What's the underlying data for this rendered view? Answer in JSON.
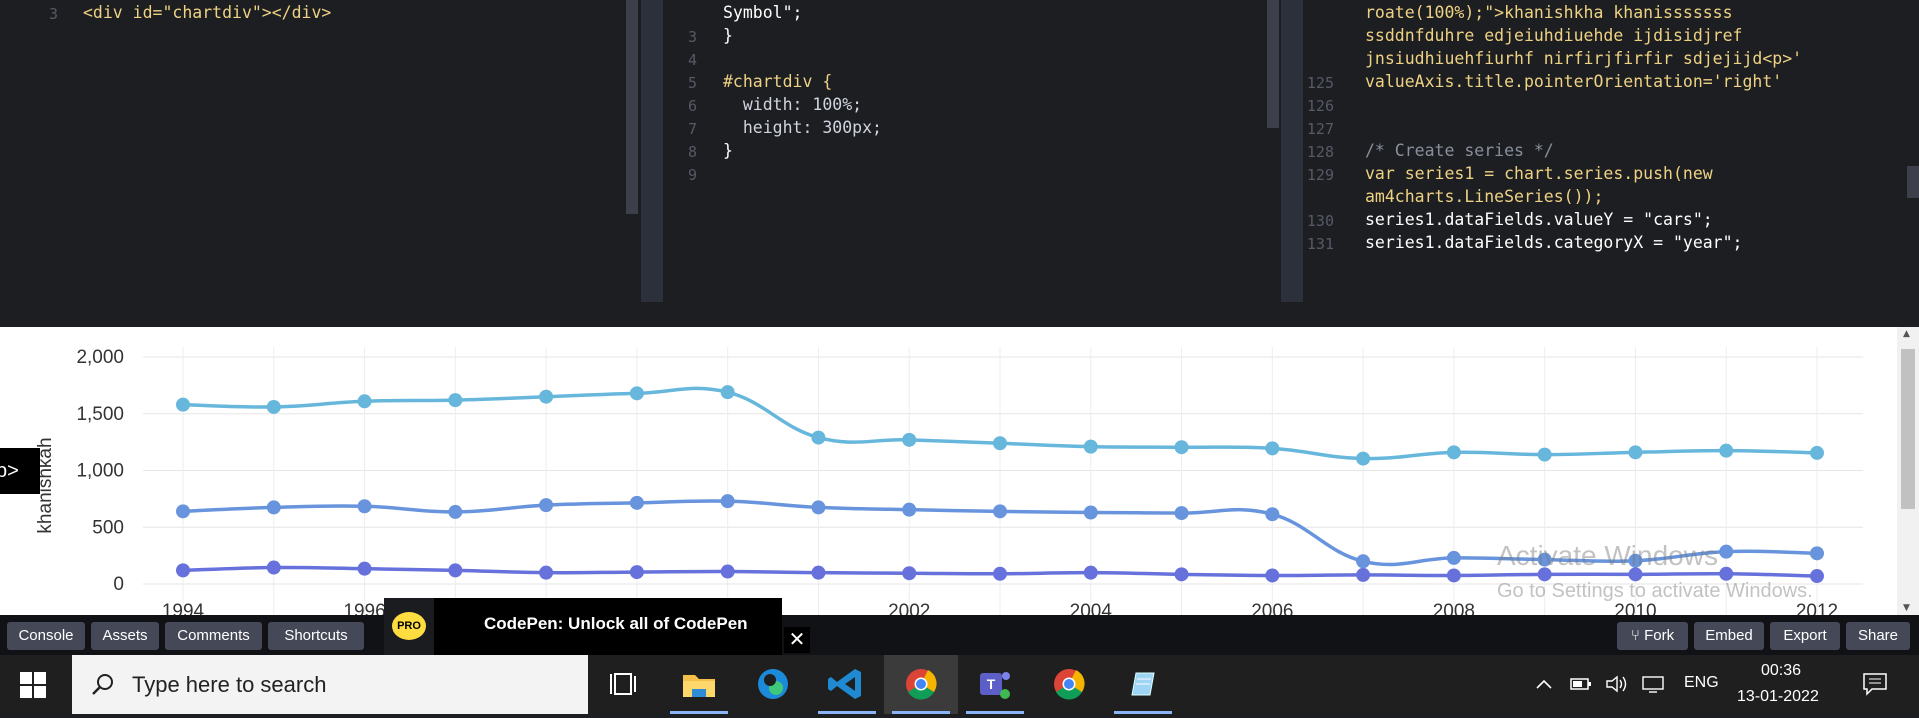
{
  "editor": {
    "html_pane": {
      "lines": [
        {
          "num": "3",
          "code": "<div id=\"chartdiv\"></div>"
        }
      ]
    },
    "css_pane": {
      "lines": [
        {
          "num": "",
          "code": "Symbol\";"
        },
        {
          "num": "3",
          "code": "}"
        },
        {
          "num": "4",
          "code": ""
        },
        {
          "num": "5",
          "code": "#chartdiv {"
        },
        {
          "num": "6",
          "code": "  width: 100%;"
        },
        {
          "num": "7",
          "code": "  height: 300px;"
        },
        {
          "num": "8",
          "code": "}"
        },
        {
          "num": "9",
          "code": ""
        }
      ]
    },
    "js_pane": {
      "lines": [
        {
          "num": "",
          "code": "roate(100%);\">khanishkha khanisssssss"
        },
        {
          "num": "",
          "code": "ssddnfduhre edjeiuhdiuehde ijdisidjref"
        },
        {
          "num": "",
          "code": "jnsiudhiuehfiurhf nirfirjfirfir sdjejijd<p>'"
        },
        {
          "num": "125",
          "code": "valueAxis.title.pointerOrientation='right'"
        },
        {
          "num": "126",
          "code": ""
        },
        {
          "num": "127",
          "code": ""
        },
        {
          "num": "128",
          "code": "/* Create series */"
        },
        {
          "num": "129",
          "code": "var series1 = chart.series.push(new"
        },
        {
          "num": "",
          "code": "am4charts.LineSeries());"
        },
        {
          "num": "130",
          "code": "series1.dataFields.valueY = \"cars\";"
        },
        {
          "num": "131",
          "code": "series1.dataFields.categoryX = \"year\";"
        }
      ]
    }
  },
  "preview": {
    "side_tab": "p>",
    "watermark_title": "Activate Windows",
    "watermark_sub": "Go to Settings to activate Windows."
  },
  "chart_data": {
    "type": "line",
    "x": [
      1994,
      1995,
      1996,
      1997,
      1998,
      1999,
      2000,
      2001,
      2002,
      2003,
      2004,
      2005,
      2006,
      2007,
      2008,
      2009,
      2010,
      2011,
      2012
    ],
    "x_tick_labels": [
      "1994",
      "1996",
      "2002",
      "2004",
      "2006",
      "2008",
      "2010",
      "2012"
    ],
    "y_tick_labels": [
      "2,000",
      "1,500",
      "1,000",
      "500",
      "0"
    ],
    "ylabel": "khanishkah",
    "ylim": [
      0,
      2000
    ],
    "smoothed": true,
    "grid": true,
    "series": [
      {
        "color": "#67b7dc",
        "values": [
          1580,
          1560,
          1610,
          1620,
          1650,
          1680,
          1690,
          1290,
          1270,
          1240,
          1210,
          1205,
          1195,
          1105,
          1160,
          1140,
          1160,
          1175,
          1155
        ]
      },
      {
        "color": "#6794dc",
        "values": [
          640,
          675,
          685,
          635,
          695,
          715,
          730,
          675,
          655,
          640,
          630,
          625,
          615,
          200,
          230,
          215,
          205,
          285,
          270
        ]
      },
      {
        "color": "#6771dc",
        "values": [
          120,
          145,
          135,
          120,
          100,
          105,
          110,
          100,
          95,
          90,
          100,
          85,
          75,
          80,
          75,
          85,
          85,
          90,
          70
        ]
      }
    ]
  },
  "codepen_bar": {
    "left_buttons": [
      "Console",
      "Assets",
      "Comments",
      "Shortcuts"
    ],
    "promo_badge": "PRO",
    "promo_text": "CodePen: Unlock all of CodePen",
    "promo_close": "✕",
    "right_buttons": [
      "Fork",
      "Embed",
      "Export",
      "Share"
    ],
    "fork_icon": "⑂"
  },
  "taskbar": {
    "search_placeholder": "Type here to search",
    "language": "ENG",
    "time": "00:36",
    "date": "13-01-2022",
    "icons": [
      "task-view",
      "file-explorer",
      "edge",
      "vscode",
      "chrome",
      "teams",
      "chrome",
      "notepad-app"
    ]
  }
}
